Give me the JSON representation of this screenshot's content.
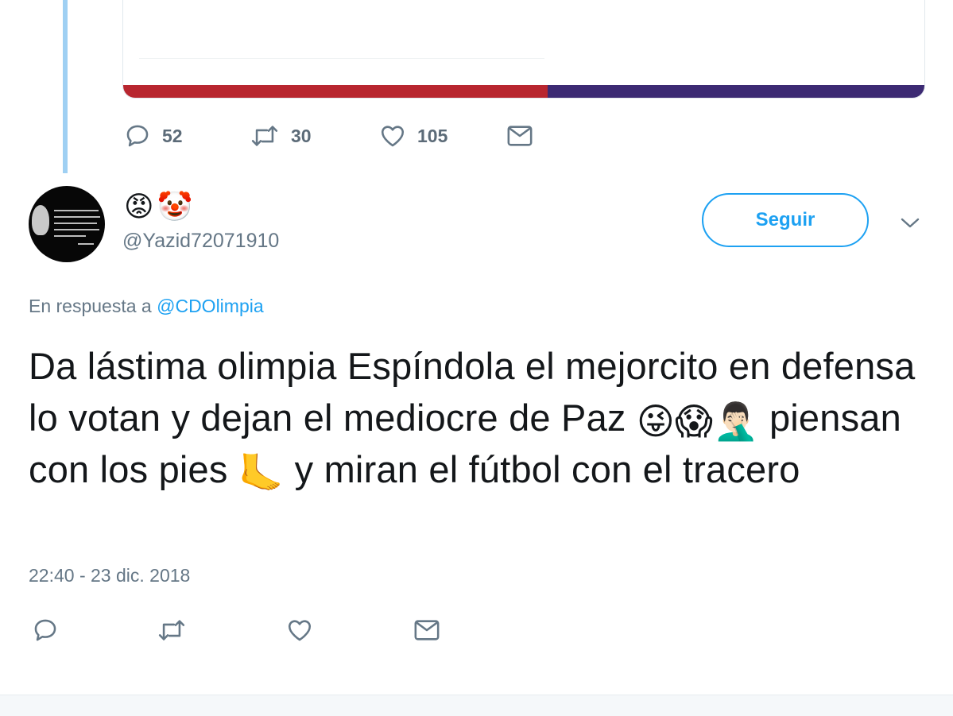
{
  "quoted_tweet": {
    "stats": {
      "replies": "52",
      "retweets": "30",
      "likes": "105"
    }
  },
  "reply_tweet": {
    "name_emojis": [
      "😡",
      "🤡"
    ],
    "handle": "@Yazid72071910",
    "follow_label": "Seguir",
    "reply_prefix": "En respuesta a",
    "reply_mention": "@CDOlimpia",
    "text_1": "Da lástima olimpia Espíndola el mejorcito en defensa lo votan y dejan el mediocre de Paz",
    "emoji_1": "😜",
    "emoji_2": "😱",
    "emoji_3": "🤦🏻‍♂️",
    "text_2": "piensan con los pies",
    "emoji_4": "🦶",
    "text_3": "y miran el fútbol con el tracero",
    "timestamp": "22:40 - 23 dic. 2018"
  },
  "colors": {
    "accent": "#1da1f2",
    "muted": "#657786",
    "thread_line": "#9fd0f3",
    "bar_red": "#b8262f",
    "bar_blue": "#3c2a73"
  },
  "icons": [
    "reply-icon",
    "retweet-icon",
    "like-icon",
    "direct-message-icon",
    "chevron-down-icon"
  ]
}
